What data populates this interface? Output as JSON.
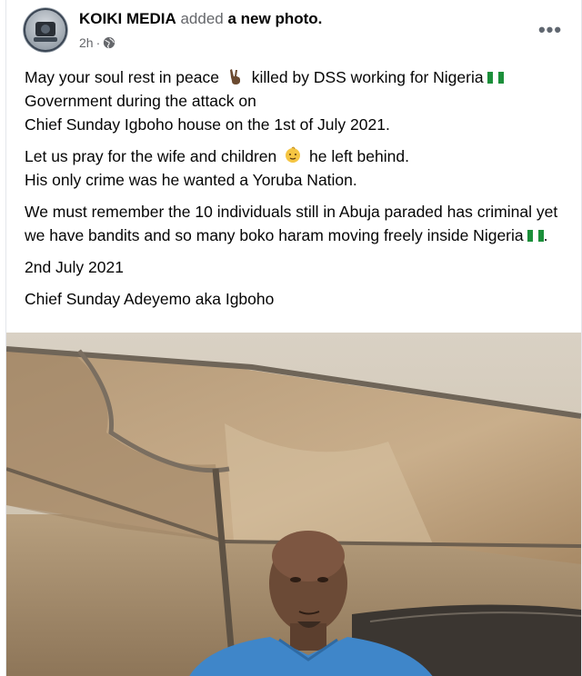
{
  "post": {
    "author": "KOIKI MEDIA",
    "action_prefix": "added",
    "action_object": "a new photo.",
    "time": "2h",
    "separator": "·",
    "privacy_icon": "globe-icon",
    "more_icon": "more-options-icon",
    "more_label": "•••",
    "paragraphs": {
      "p1": {
        "a": "May your soul rest in peace",
        "b": "killed by DSS working for Nigeria",
        "c": "Government during the attack on",
        "d": "Chief Sunday Igboho house on the 1st of July 2021."
      },
      "p2": {
        "a": "Let us pray for the wife and children",
        "b": "he left behind.",
        "c": "His only crime was  he wanted a Yoruba Nation."
      },
      "p3": {
        "a": "We must remember the 10 individuals still in Abuja paraded has criminal yet we have bandits and so many boko haram moving freely inside Nigeria",
        "b": "."
      },
      "p4": "2nd July 2021",
      "p5": "Chief Sunday Adeyemo aka Igboho"
    },
    "emojis": [
      "victory-hand-icon",
      "nigeria-flag-icon",
      "baby-icon"
    ]
  },
  "colors": {
    "text": "#050505",
    "secondary": "#65676b",
    "flag_green": "#1b8f3a"
  }
}
